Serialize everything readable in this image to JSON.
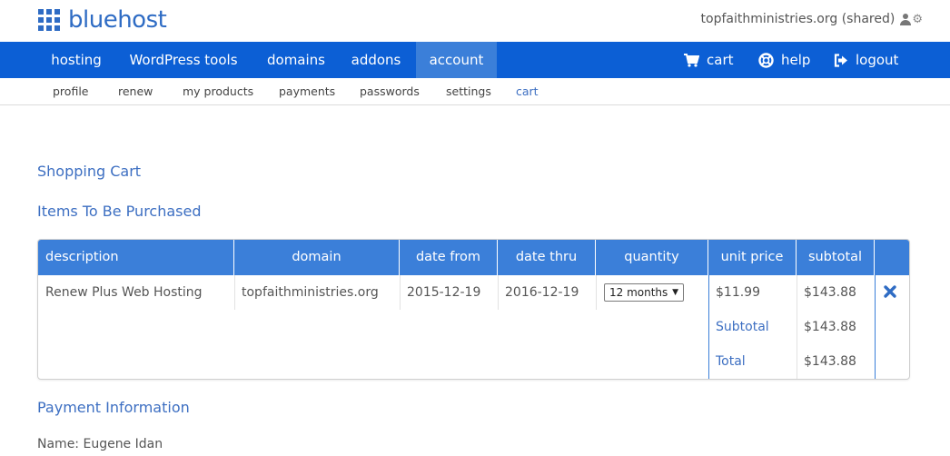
{
  "logo": {
    "text": "bluehost"
  },
  "account": {
    "domain_label": "topfaithministries.org (shared)"
  },
  "nav": {
    "items": [
      {
        "label": "hosting"
      },
      {
        "label": "WordPress tools"
      },
      {
        "label": "domains"
      },
      {
        "label": "addons"
      },
      {
        "label": "account"
      }
    ],
    "right": [
      {
        "label": "cart",
        "icon": "cart-icon"
      },
      {
        "label": "help",
        "icon": "lifebuoy-icon"
      },
      {
        "label": "logout",
        "icon": "logout-icon"
      }
    ]
  },
  "subnav": {
    "items": [
      {
        "label": "profile"
      },
      {
        "label": "renew"
      },
      {
        "label": "my products"
      },
      {
        "label": "payments"
      },
      {
        "label": "passwords"
      },
      {
        "label": "settings"
      },
      {
        "label": "cart"
      }
    ]
  },
  "page": {
    "title": "Shopping Cart",
    "items_heading": "Items To Be Purchased",
    "payment_heading": "Payment Information",
    "payment_name": "Name: Eugene Idan"
  },
  "cart": {
    "headers": [
      "description",
      "domain",
      "date from",
      "date thru",
      "quantity",
      "unit price",
      "subtotal"
    ],
    "row": {
      "description": "Renew Plus Web Hosting",
      "domain": "topfaithministries.org",
      "date_from": "2015-12-19",
      "date_thru": "2016-12-19",
      "quantity": "12 months",
      "unit_price": "$11.99",
      "subtotal": "$143.88"
    },
    "subtotal_label": "Subtotal",
    "subtotal_value": "$143.88",
    "total_label": "Total",
    "total_value": "$143.88"
  },
  "colors": {
    "nav_bg": "#0c5fd5",
    "nav_active": "#3b7fd9",
    "header_bg": "#3b7fd9",
    "link": "#3d6fc2",
    "remove": "#2f6cc4"
  }
}
